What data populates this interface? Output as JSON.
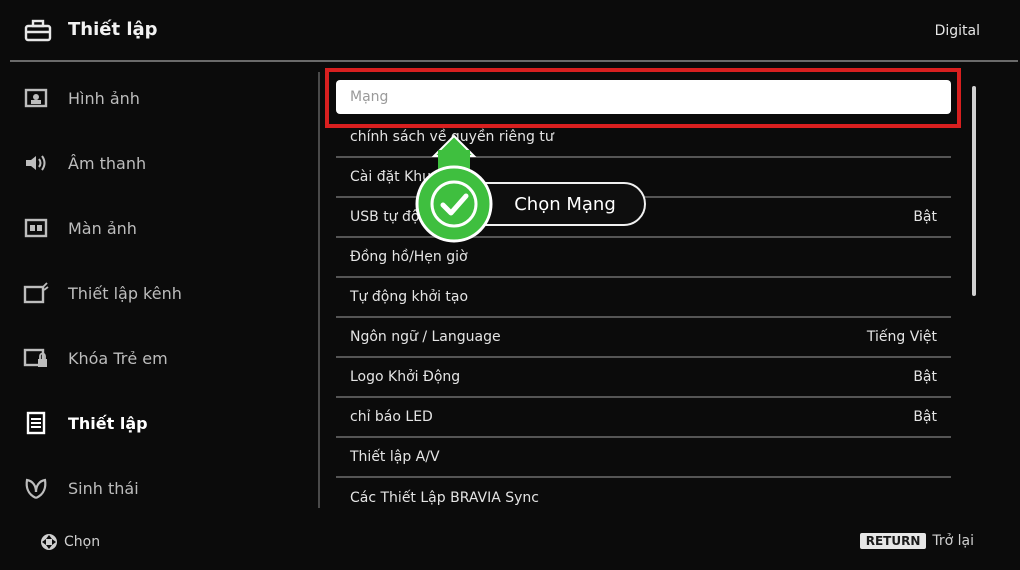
{
  "header": {
    "title": "Thiết lập",
    "source": "Digital"
  },
  "sidebar": {
    "items": [
      {
        "label": "Hình ảnh",
        "icon": "picture-icon",
        "active": false
      },
      {
        "label": "Âm thanh",
        "icon": "speaker-icon",
        "active": false
      },
      {
        "label": "Màn ảnh",
        "icon": "screen-icon",
        "active": false
      },
      {
        "label": "Thiết lập kênh",
        "icon": "channel-icon",
        "active": false
      },
      {
        "label": "Khóa Trẻ em",
        "icon": "child-lock-icon",
        "active": false
      },
      {
        "label": "Thiết lập",
        "icon": "settings-icon",
        "active": true
      },
      {
        "label": "Sinh thái",
        "icon": "eco-icon",
        "active": false
      }
    ]
  },
  "menu": {
    "selected": "Mạng",
    "rows": [
      {
        "label": "chính sách về quyền riêng tư",
        "value": ""
      },
      {
        "label": "Cài đặt Khu",
        "value": ""
      },
      {
        "label": "USB tự độ",
        "value": "Bật"
      },
      {
        "label": "Đồng hồ/Hẹn giờ",
        "value": ""
      },
      {
        "label": "Tự động khởi tạo",
        "value": ""
      },
      {
        "label": "Ngôn ngữ / Language",
        "value": "Tiếng Việt"
      },
      {
        "label": "Logo Khởi Động",
        "value": "Bật"
      },
      {
        "label": "chỉ báo LED",
        "value": "Bật"
      },
      {
        "label": "Thiết lập A/V",
        "value": ""
      },
      {
        "label": "Các Thiết Lập BRAVIA Sync",
        "value": ""
      }
    ]
  },
  "tip": {
    "text": "Chọn Mạng",
    "icon": "check-icon",
    "accent": "#3fbf3f"
  },
  "footer": {
    "select_label": "Chọn",
    "return_key": "RETURN",
    "return_label": "Trở lại"
  },
  "colors": {
    "highlight_frame": "#d81f1f",
    "background": "#0b0b0b"
  }
}
